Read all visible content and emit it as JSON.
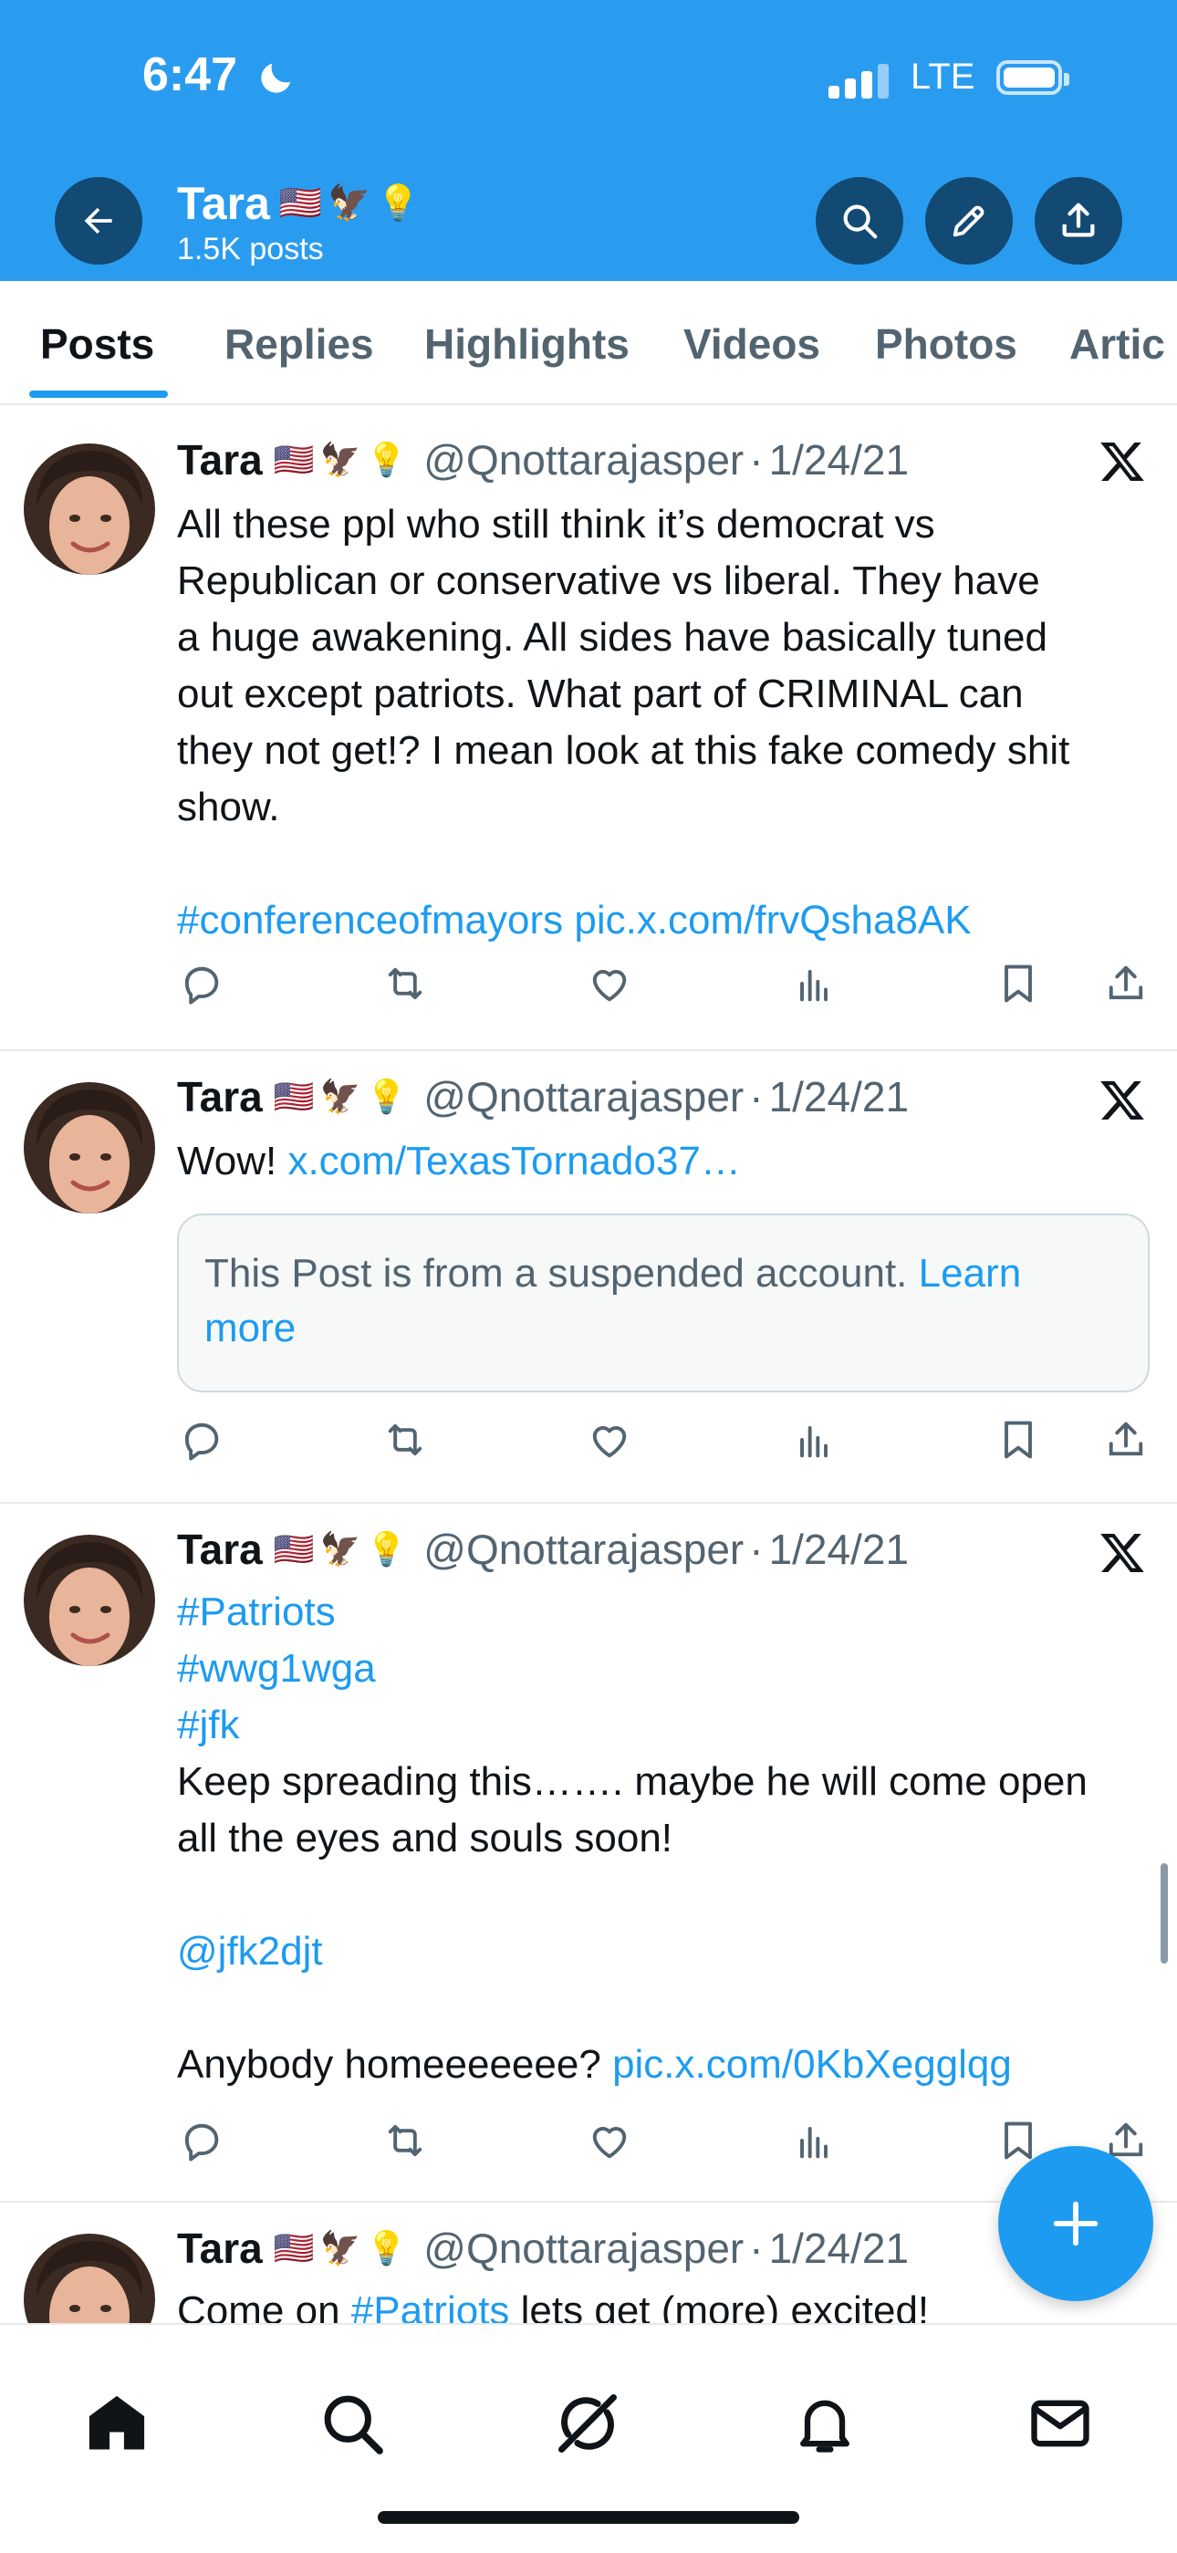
{
  "status_bar": {
    "time": "6:47",
    "network": "LTE"
  },
  "profile": {
    "name": "Tara",
    "emojis": [
      "🇺🇸",
      "🦅",
      "💡"
    ],
    "post_count": "1.5K posts"
  },
  "tabs": [
    {
      "label": "Posts",
      "active": true
    },
    {
      "label": "Replies"
    },
    {
      "label": "Highlights"
    },
    {
      "label": "Videos"
    },
    {
      "label": "Photos"
    },
    {
      "label": "Artic"
    }
  ],
  "posts": [
    {
      "name": "Tara",
      "handle": "@Qnottarajasper",
      "sep": "·",
      "date": "1/24/21",
      "lines": [
        "All these ppl who still think it’s democrat vs",
        "Republican or conservative vs liberal.  They have",
        "a huge awakening. All sides have basically tuned",
        "out except patriots. What part of CRIMINAL can",
        "they not get!? I mean look at this fake comedy shit",
        "show."
      ],
      "hashtag": "#conferenceofmayors",
      "link": "pic.x.com/frvQsha8AK"
    },
    {
      "name": "Tara",
      "handle": "@Qnottarajasper",
      "sep": "·",
      "date": "1/24/21",
      "text": "Wow!",
      "link": "x.com/TexasTornado37…",
      "suspended_text": "This Post is from a suspended account.",
      "learn_more": "Learn more"
    },
    {
      "name": "Tara",
      "handle": "@Qnottarajasper",
      "sep": "·",
      "date": "1/24/21",
      "hashtags": [
        "#Patriots",
        "#wwg1wga",
        "#jfk"
      ],
      "lines": [
        "Keep spreading this……. maybe he will come open",
        "all the eyes and souls soon!"
      ],
      "mention": "@jfk2djt",
      "last_text": "Anybody homeeeeeee?",
      "link": "pic.x.com/0KbXegglqg"
    },
    {
      "name": "Tara",
      "handle": "@Qnottarajasper",
      "sep": "·",
      "date": "1/24/21",
      "text_start": "Come on",
      "hashtag": "#Patriots",
      "text_end": "lets get (more) excited!"
    }
  ],
  "colors": {
    "header": "#2a9cf0",
    "accent": "#1d9bf0",
    "button_dark": "#124a73",
    "muted": "#536471"
  },
  "icons": {
    "header": [
      "back-arrow-icon",
      "search-icon",
      "edit-icon",
      "share-icon"
    ],
    "post_actions": [
      "reply-icon",
      "repost-icon",
      "like-icon",
      "views-icon",
      "bookmark-icon",
      "share-icon"
    ],
    "nav": [
      "home-icon",
      "search-icon",
      "grok-icon",
      "notifications-icon",
      "messages-icon"
    ]
  }
}
